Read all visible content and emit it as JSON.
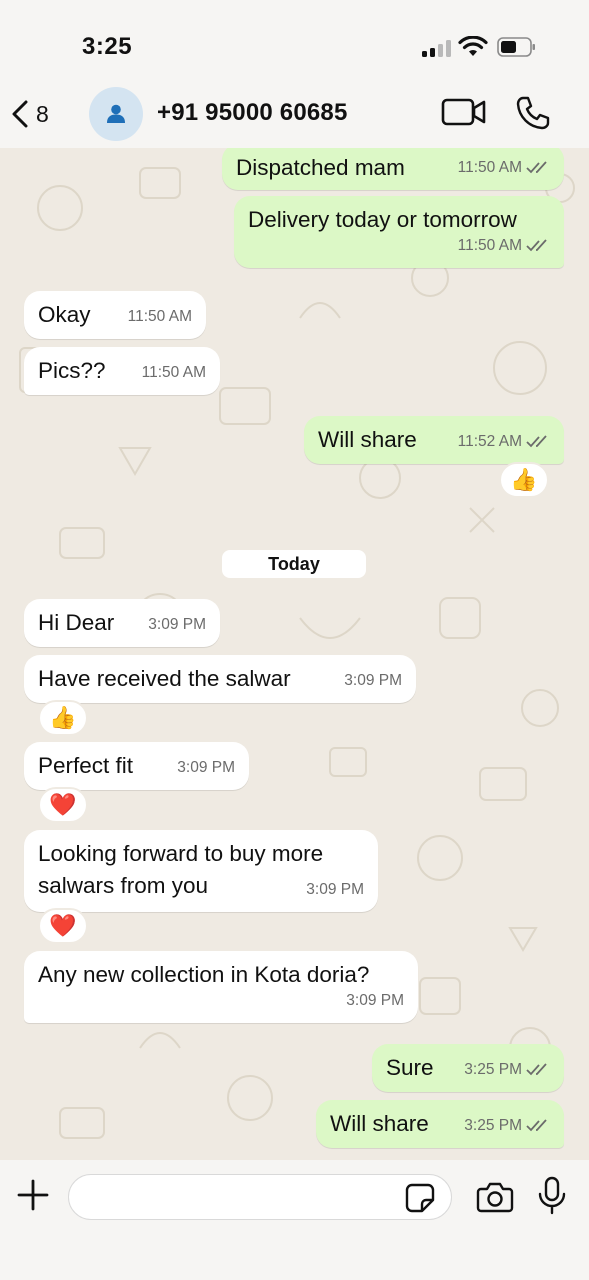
{
  "status_bar": {
    "time": "3:25"
  },
  "header": {
    "back_count": "8",
    "contact_name": "+91 95000 60685"
  },
  "date_separator": "Today",
  "messages": [
    {
      "text": "Dispatched mam",
      "time": "11:50 AM",
      "direction": "outgoing",
      "status": "read"
    },
    {
      "text": "Delivery today or tomorrow",
      "time": "11:50 AM",
      "direction": "outgoing",
      "status": "read"
    },
    {
      "text": "Okay",
      "time": "11:50 AM",
      "direction": "incoming"
    },
    {
      "text": "Pics??",
      "time": "11:50 AM",
      "direction": "incoming"
    },
    {
      "text": "Will share",
      "time": "11:52 AM",
      "direction": "outgoing",
      "status": "read",
      "reaction": "👍"
    },
    {
      "text": "Hi Dear",
      "time": "3:09 PM",
      "direction": "incoming"
    },
    {
      "text": "Have received the salwar",
      "time": "3:09 PM",
      "direction": "incoming",
      "reaction": "👍"
    },
    {
      "text": "Perfect fit",
      "time": "3:09 PM",
      "direction": "incoming",
      "reaction": "❤️"
    },
    {
      "text": "Looking forward to buy more salwars from you",
      "time": "3:09 PM",
      "direction": "incoming",
      "reaction": "❤️"
    },
    {
      "text": "Any new collection in Kota doria?",
      "time": "3:09 PM",
      "direction": "incoming"
    },
    {
      "text": "Sure",
      "time": "3:25 PM",
      "direction": "outgoing",
      "status": "read"
    },
    {
      "text": "Will share",
      "time": "3:25 PM",
      "direction": "outgoing",
      "status": "read"
    }
  ],
  "composer": {
    "input_value": ""
  },
  "icons": {
    "back": "chevron-left-icon",
    "avatar": "person-icon",
    "video": "video-camera-icon",
    "call": "phone-icon",
    "plus": "plus-icon",
    "sticker": "sticker-icon",
    "camera": "camera-icon",
    "mic": "microphone-icon"
  },
  "colors": {
    "outgoing_bubble": "#dcf8c6",
    "incoming_bubble": "#ffffff",
    "chat_background": "#efeae2",
    "read_ticks": "#53bdeb",
    "ticks_shown": "#6b6b6b"
  }
}
